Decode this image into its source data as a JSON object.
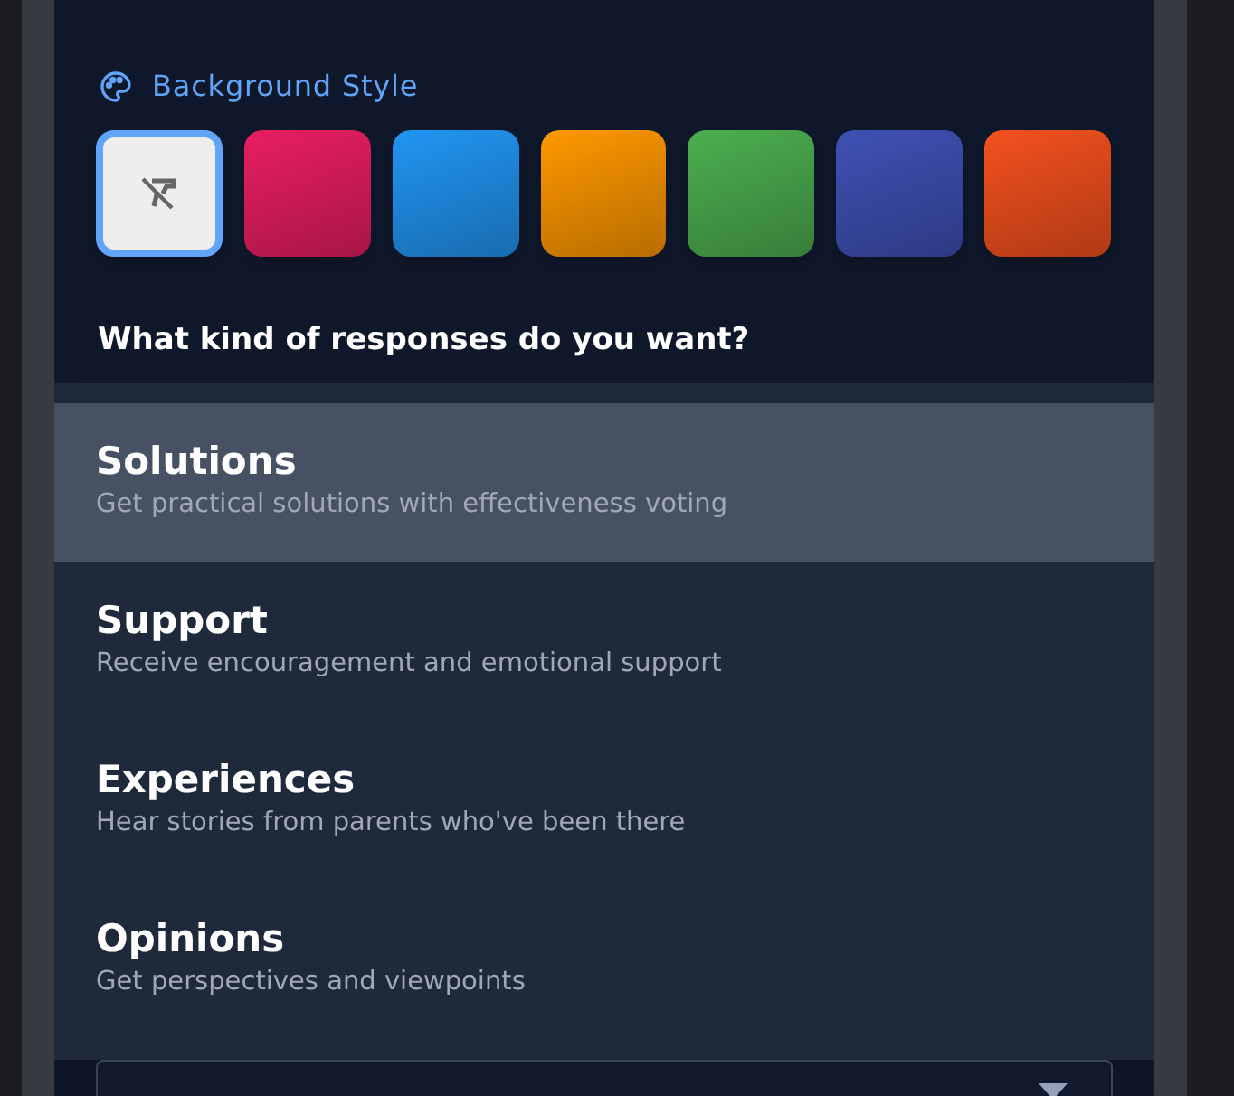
{
  "background_style": {
    "label": "Background Style",
    "swatches": [
      {
        "kind": "none",
        "selected": true
      },
      {
        "kind": "gradient",
        "color": "#e91e63",
        "selected": false
      },
      {
        "kind": "gradient",
        "color": "#2196f3",
        "selected": false
      },
      {
        "kind": "gradient",
        "color": "#ff9800",
        "selected": false
      },
      {
        "kind": "gradient",
        "color": "#4caf50",
        "selected": false
      },
      {
        "kind": "gradient",
        "color": "#3f51b5",
        "selected": false
      },
      {
        "kind": "gradient",
        "color": "#f4511e",
        "selected": false
      }
    ]
  },
  "question": "What kind of responses do you want?",
  "response_options": [
    {
      "title": "Solutions",
      "description": "Get practical solutions with effectiveness voting",
      "selected": true
    },
    {
      "title": "Support",
      "description": "Receive encouragement and emotional support",
      "selected": false
    },
    {
      "title": "Experiences",
      "description": "Hear stories from parents who've been there",
      "selected": false
    },
    {
      "title": "Opinions",
      "description": "Get perspectives and viewpoints",
      "selected": false
    }
  ]
}
